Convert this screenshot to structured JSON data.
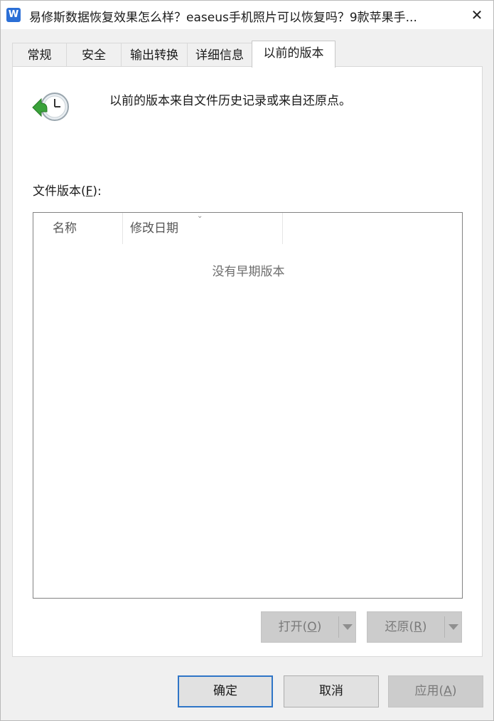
{
  "window": {
    "title": "易修斯数据恢复效果怎么样？easeus手机照片可以恢复吗？9款苹果手...",
    "app_icon_letter": "W",
    "close_symbol": "✕"
  },
  "tabs": [
    {
      "label": "常规",
      "active": false
    },
    {
      "label": "安全",
      "active": false
    },
    {
      "label": "输出转换",
      "active": false
    },
    {
      "label": "详细信息",
      "active": false
    },
    {
      "label": "以前的版本",
      "active": true
    }
  ],
  "panel": {
    "description": "以前的版本来自文件历史记录或来自还原点。",
    "icon": "clock-restore-icon",
    "versions_label_text": "文件版本",
    "versions_label_key": "F",
    "columns": [
      "名称",
      "修改日期"
    ],
    "empty_message": "没有早期版本"
  },
  "split_buttons": {
    "open": {
      "label": "打开",
      "key": "O",
      "enabled": false
    },
    "restore": {
      "label": "还原",
      "key": "R",
      "enabled": false
    }
  },
  "footer": {
    "ok": "确定",
    "cancel": "取消",
    "apply_label": "应用",
    "apply_key": "A"
  },
  "colors": {
    "accent_border": "#2f75c7",
    "disabled_bg": "#cccccc",
    "disabled_text": "#7a7a7a",
    "icon_green": "#3aa23a"
  }
}
